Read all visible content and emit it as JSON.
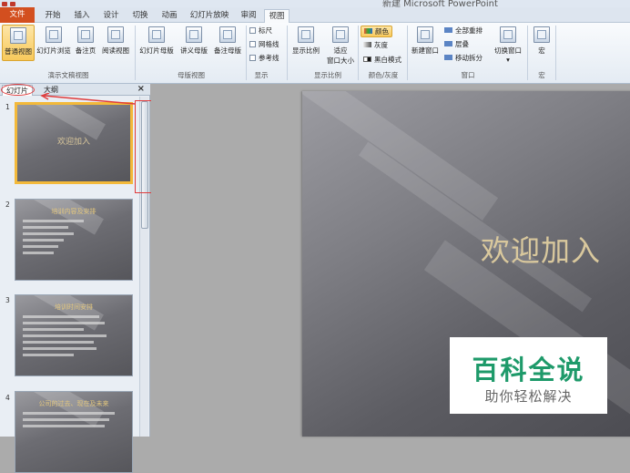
{
  "window": {
    "title": "新建 Microsoft PowerPoint"
  },
  "tabs": [
    "文件",
    "开始",
    "插入",
    "设计",
    "切换",
    "动画",
    "幻灯片放映",
    "审阅",
    "视图"
  ],
  "ribbon": {
    "presentation_views": {
      "label": "演示文稿视图",
      "buttons": [
        "普通视图",
        "幻灯片浏览",
        "备注页",
        "阅读视图"
      ]
    },
    "master_views": {
      "label": "母版视图",
      "buttons": [
        "幻灯片母版",
        "讲义母版",
        "备注母版"
      ]
    },
    "show": {
      "label": "显示",
      "checks": [
        "标尺",
        "网格线",
        "参考线"
      ]
    },
    "zoom": {
      "label": "显示比例",
      "buttons": [
        "显示比例",
        "适应",
        "窗口大小"
      ]
    },
    "color": {
      "label": "颜色/灰度",
      "options": [
        "颜色",
        "灰度",
        "黑白模式"
      ]
    },
    "window": {
      "label": "窗口",
      "buttons": [
        "新建窗口",
        "全部重排",
        "层叠",
        "移动拆分",
        "切换窗口"
      ]
    },
    "macro": {
      "label": "宏",
      "button": "宏"
    }
  },
  "panel": {
    "tabs": [
      "幻灯片",
      "大纲"
    ],
    "close": "×",
    "slides": [
      {
        "num": "1",
        "title": "欢迎加入"
      },
      {
        "num": "2",
        "title": "培训内容及安排"
      },
      {
        "num": "3",
        "title": "培训时间安排"
      },
      {
        "num": "4",
        "title": "公司的过去、现在及未来"
      }
    ]
  },
  "slide": {
    "title": "欢迎加入"
  },
  "watermark": {
    "main": "百科全说",
    "sub": "助你轻松解决"
  }
}
